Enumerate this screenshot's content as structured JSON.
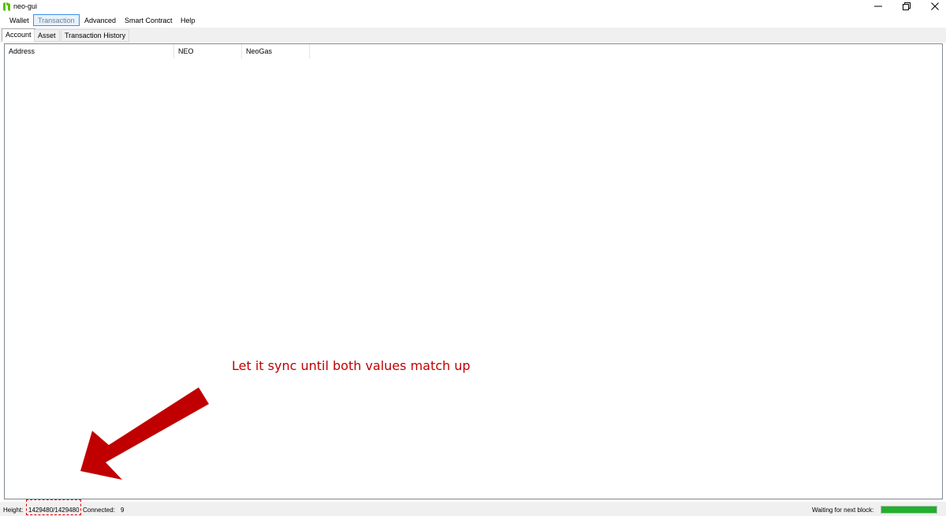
{
  "window": {
    "title": "neo-gui",
    "minimize_icon": "minimize-icon",
    "maximize_icon": "restore-icon",
    "close_icon": "close-icon"
  },
  "menu": {
    "items": [
      "Wallet",
      "Transaction",
      "Advanced",
      "Smart Contract",
      "Help"
    ],
    "active": "Transaction"
  },
  "tabs": {
    "items": [
      "Account",
      "Asset",
      "Transaction History"
    ],
    "selected": "Account"
  },
  "account_list": {
    "columns": [
      "Address",
      "NEO",
      "NeoGas"
    ],
    "rows": []
  },
  "annotation": {
    "text": "Let it sync until both values match up",
    "color": "#c00000"
  },
  "status": {
    "height_label": "Height:",
    "height_value": "1429480/1429480",
    "connected_label": "Connected:",
    "connected_value": "9",
    "waiting_label": "Waiting for next block:",
    "block_progress": 1.0,
    "progress_color": "#1fb12c"
  }
}
